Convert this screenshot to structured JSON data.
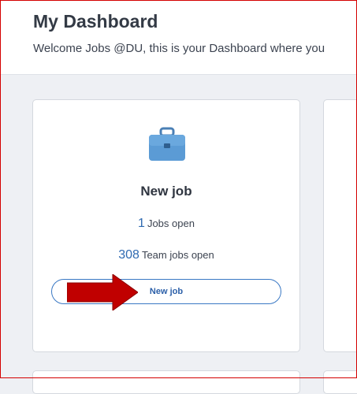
{
  "header": {
    "title": "My Dashboard",
    "welcome_text": "Welcome Jobs @DU, this is your Dashboard where you"
  },
  "job_card": {
    "icon": "briefcase-icon",
    "title": "New job",
    "jobs_open_count": "1",
    "jobs_open_label": "Jobs open",
    "team_jobs_open_count": "308",
    "team_jobs_open_label": "Team jobs open",
    "button_label": "New job"
  },
  "annotation": {
    "icon": "red-arrow-icon",
    "color": "#c00000"
  },
  "colors": {
    "accent": "#2f6ab1",
    "briefcase": "#5b9bd5",
    "border_highlight": "#d40000"
  }
}
